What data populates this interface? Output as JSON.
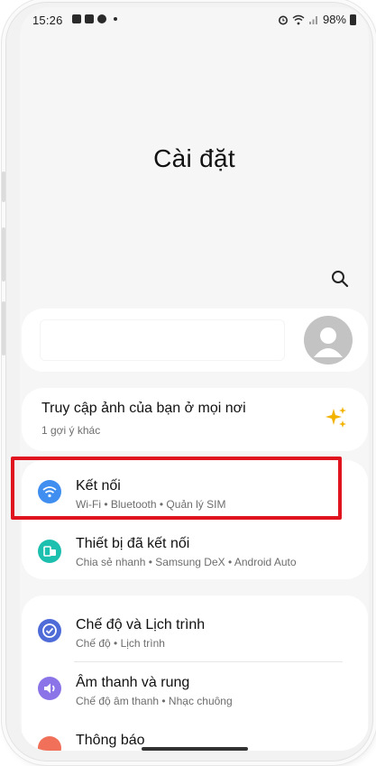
{
  "status_bar": {
    "time": "15:26",
    "left_icons": [
      "calendar-icon",
      "gallery-icon",
      "messenger-icon",
      "dot-icon"
    ],
    "right_icons": [
      "alarm-icon",
      "wifi-icon",
      "signal-icon"
    ],
    "battery": "98%"
  },
  "page": {
    "title": "Cài đặt"
  },
  "photo_suggestion": {
    "title": "Truy cập ảnh của bạn ở mọi nơi",
    "subtitle": "1 gợi ý khác",
    "icon": "sparkle-icon",
    "icon_color": "#f2b300"
  },
  "settings": [
    {
      "title": "Kết nối",
      "subtitle": "Wi-Fi  •  Bluetooth  •  Quản lý SIM",
      "icon": "wifi-icon",
      "icon_color": "#3f8ef0",
      "highlighted": true
    },
    {
      "title": "Thiết bị đã kết nối",
      "subtitle": "Chia sẻ nhanh  •  Samsung DeX  •  Android Auto",
      "icon": "connected-devices-icon",
      "icon_color": "#1dbfae"
    },
    {
      "title": "Chế độ và Lịch trình",
      "subtitle": "Chế độ  •  Lịch trình",
      "icon": "modes-check-icon",
      "icon_color": "#4f6bd8"
    },
    {
      "title": "Âm thanh và rung",
      "subtitle": "Chế độ âm thanh  •  Nhạc chuông",
      "icon": "speaker-icon",
      "icon_color": "#8a74e8"
    },
    {
      "title": "Thông báo",
      "subtitle": "",
      "icon": "notification-icon",
      "icon_color": "#f0705a"
    }
  ],
  "highlight_color": "#e0141e"
}
